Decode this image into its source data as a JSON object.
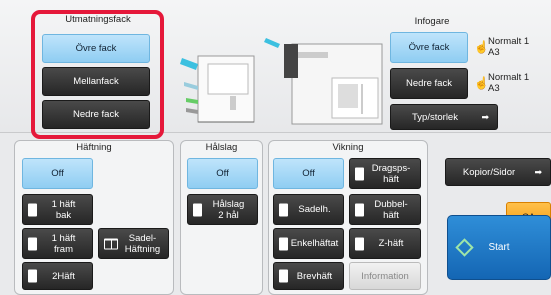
{
  "output_tray": {
    "title": "Utmatningsfack",
    "buttons": [
      "Övre fack",
      "Mellanfack",
      "Nedre fack"
    ]
  },
  "inserter": {
    "title": "Infogare",
    "upper": {
      "label": "Övre fack",
      "paper": "Normalt 1\nA3"
    },
    "lower": {
      "label": "Nedre fack",
      "paper": "Normalt 1\nA3"
    },
    "type_size": "Typ/storlek"
  },
  "stapling": {
    "title": "Häftning",
    "off": "Off",
    "one_back": "1 häft\nbak",
    "one_front": "1 häft\nfram",
    "saddle": "Sadel-\nHäftning",
    "two": "2Häft"
  },
  "punch": {
    "title": "Hålslag",
    "off": "Off",
    "two_hole": "Hålslag\n2 hål"
  },
  "folding": {
    "title": "Vikning",
    "off": "Off",
    "accordion": "Dragsps-\nhäft",
    "saddle": "Sadelh.",
    "double": "Dubbel-\nhäft",
    "single": "Enkelhäftat",
    "z": "Z-häft",
    "letter": "Brevhäft",
    "info": "Information"
  },
  "right": {
    "copies_pages": "Kopior/Sidor",
    "ca": "CA",
    "start": "Start"
  },
  "colors": {
    "red_highlight": "#e5183a",
    "blue_button": "#9fd6f6",
    "dark_button": "#2f2f2f",
    "start_blue": "#1e78c8",
    "ca_orange": "#f7a21b"
  }
}
